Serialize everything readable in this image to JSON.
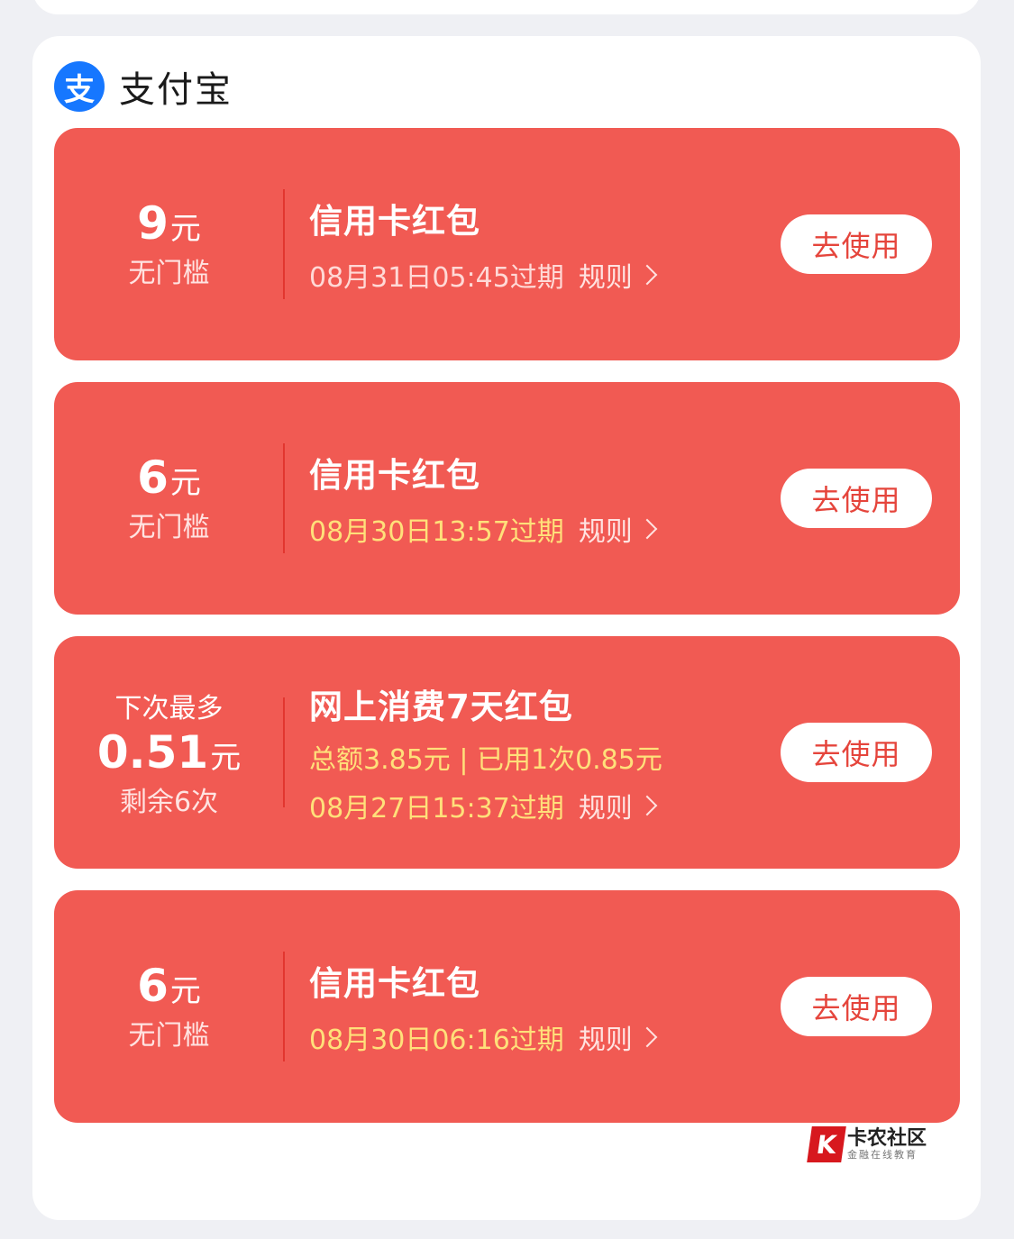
{
  "section": {
    "title": "支付宝",
    "logo_glyph": "支",
    "brand_color": "#1677ff"
  },
  "coupons": [
    {
      "amount": "9",
      "unit": "元",
      "sub": "无门槛",
      "title": "信用卡红包",
      "expiry": "08月31日05:45过期",
      "rules": "规则",
      "button": "去使用"
    },
    {
      "amount": "6",
      "unit": "元",
      "sub": "无门槛",
      "title": "信用卡红包",
      "expiry": "08月30日13:57过期",
      "rules": "规则",
      "button": "去使用"
    },
    {
      "top": "下次最多",
      "amount": "0.51",
      "unit": "元",
      "sub": "剩余6次",
      "title": "网上消费7天红包",
      "detail": "总额3.85元 | 已用1次0.85元",
      "expiry": "08月27日15:37过期",
      "rules": "规则",
      "button": "去使用"
    },
    {
      "amount": "6",
      "unit": "元",
      "sub": "无门槛",
      "title": "信用卡红包",
      "expiry": "08月30日06:16过期",
      "rules": "规则",
      "button": "去使用"
    }
  ],
  "watermark": {
    "icon": "K",
    "name": "卡农社区",
    "sub": "金融在线教育"
  },
  "colors": {
    "coupon_bg": "#f15a53",
    "button_text": "#e5453c",
    "highlight_text": "#ffe07a"
  }
}
